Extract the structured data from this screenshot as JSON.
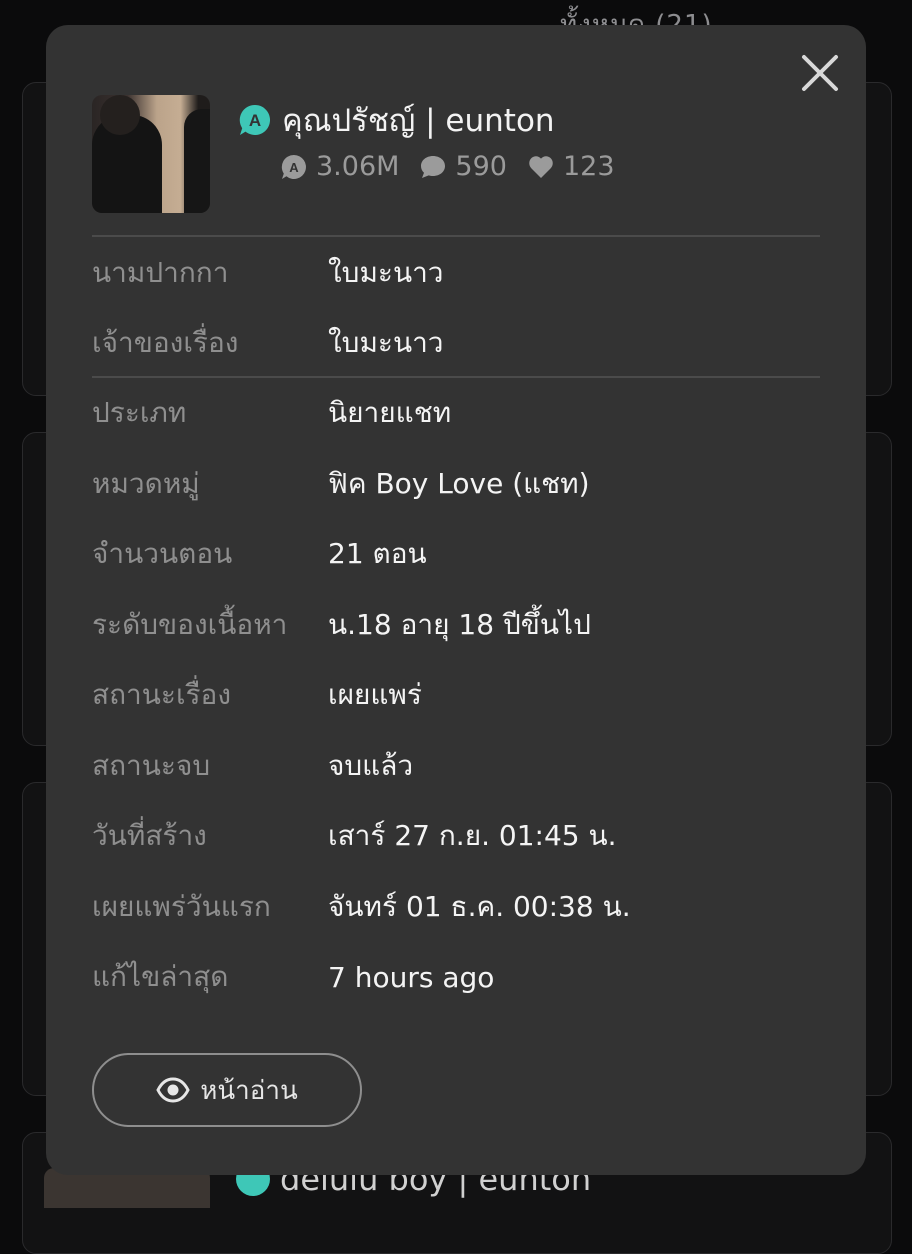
{
  "background": {
    "top_text": "ทั้งหมด (21)",
    "bottom_title": "delulu boy | eunton"
  },
  "modal": {
    "close_icon": "close-icon",
    "story": {
      "title": "คุณปรัชญ์ | eunton",
      "badge_icon": "a-badge-icon",
      "stats": {
        "views": "3.06M",
        "comments": "590",
        "likes": "123"
      }
    },
    "author_section": [
      {
        "label": "นามปากกา",
        "value": "ใบมะนาว"
      },
      {
        "label": "เจ้าของเรื่อง",
        "value": "ใบมะนาว"
      }
    ],
    "details_section": [
      {
        "label": "ประเภท",
        "value": "นิยายแชท"
      },
      {
        "label": "หมวดหมู่",
        "value": "ฟิค Boy Love (แชท)"
      },
      {
        "label": "จำนวนตอน",
        "value": "21 ตอน"
      },
      {
        "label": "ระดับของเนื้อหา",
        "value": "น.18 อายุ 18 ปีขึ้นไป"
      },
      {
        "label": "สถานะเรื่อง",
        "value": "เผยแพร่"
      },
      {
        "label": "สถานะจบ",
        "value": "จบแล้ว"
      },
      {
        "label": "วันที่สร้าง",
        "value": "เสาร์ 27 ก.ย. 01:45 น."
      },
      {
        "label": "เผยแพร่วันแรก",
        "value": "จันทร์ 01 ธ.ค. 00:38 น."
      },
      {
        "label": "แก้ไขล่าสุด",
        "value": "7 hours ago"
      }
    ],
    "read_button": {
      "label": "หน้าอ่าน",
      "icon": "eye-icon"
    },
    "colors": {
      "accent": "#3ec7b7",
      "modal_bg": "#333333"
    }
  }
}
